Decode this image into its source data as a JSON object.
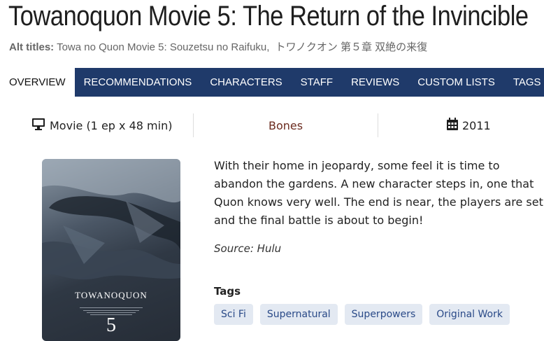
{
  "title": "Towanoquon Movie 5: The Return of the Invincible",
  "alt_titles": {
    "label": "Alt titles:",
    "values": [
      "Towa no Quon Movie 5: Souzetsu no Raifuku,",
      "トワノクオン 第５章 双絶の来復"
    ]
  },
  "tabs": [
    {
      "label": "OVERVIEW",
      "active": true
    },
    {
      "label": "RECOMMENDATIONS"
    },
    {
      "label": "CHARACTERS"
    },
    {
      "label": "STAFF"
    },
    {
      "label": "REVIEWS"
    },
    {
      "label": "CUSTOM LISTS"
    },
    {
      "label": "TAGS"
    }
  ],
  "info": {
    "format": "Movie (1 ep x 48 min)",
    "format_icon": "monitor-icon",
    "studio": "Bones",
    "year": "2011",
    "year_icon": "calendar-icon"
  },
  "poster": {
    "title": "TOWANOQUON",
    "number": "5"
  },
  "description": "With their home in jeopardy, some feel it is time to abandon the gardens. A new character steps in, one that Quon knows very well. The end is near, the players are set, and the final battle is about to begin!",
  "source": "Source: Hulu",
  "tags_heading": "Tags",
  "tags": [
    "Sci Fi",
    "Supernatural",
    "Superpowers",
    "Original Work"
  ],
  "colors": {
    "nav_bg": "#1f3a6a",
    "studio": "#6b2b1f",
    "tag_bg": "#e3e9f2",
    "tag_text": "#2a4a88"
  }
}
